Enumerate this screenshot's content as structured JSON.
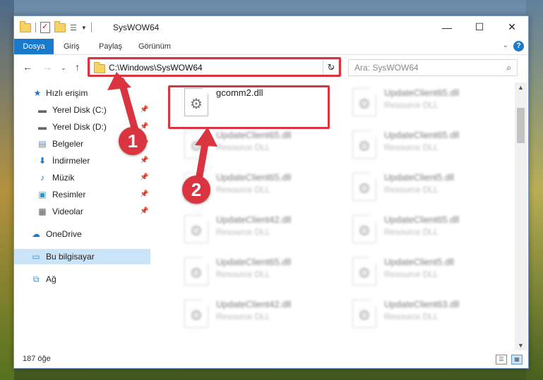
{
  "window": {
    "title": "SysWOW64"
  },
  "ribbon": {
    "tabs": [
      "Dosya",
      "Giriş",
      "Paylaş",
      "Görünüm"
    ]
  },
  "address": {
    "path": "C:\\Windows\\SysWOW64"
  },
  "search": {
    "placeholder": "Ara: SysWOW64"
  },
  "sidebar": {
    "items": [
      {
        "label": "Hızlı erişim",
        "icon": "star-icon",
        "pinned": false
      },
      {
        "label": "Yerel Disk (C:)",
        "icon": "drive-icon",
        "pinned": true
      },
      {
        "label": "Yerel Disk (D:)",
        "icon": "drive-icon",
        "pinned": true
      },
      {
        "label": "Belgeler",
        "icon": "document-icon",
        "pinned": true
      },
      {
        "label": "İndirmeler",
        "icon": "download-icon",
        "pinned": true
      },
      {
        "label": "Müzik",
        "icon": "music-icon",
        "pinned": true
      },
      {
        "label": "Resimler",
        "icon": "picture-icon",
        "pinned": true
      },
      {
        "label": "Videolar",
        "icon": "video-icon",
        "pinned": true
      },
      {
        "label": "OneDrive",
        "icon": "cloud-icon",
        "pinned": false
      },
      {
        "label": "Bu bilgisayar",
        "icon": "computer-icon",
        "pinned": false,
        "selected": true
      },
      {
        "label": "Ağ",
        "icon": "network-icon",
        "pinned": false
      }
    ]
  },
  "files": {
    "left": [
      {
        "name": "gcomm2.dll",
        "type": "",
        "blurred": false
      },
      {
        "name": "UpdateClient65.dll",
        "type": "Resource DLL",
        "blurred": true
      },
      {
        "name": "UpdateClient65.dll",
        "type": "Resource DLL",
        "blurred": true
      },
      {
        "name": "UpdateClient42.dll",
        "type": "Resource DLL",
        "blurred": true
      },
      {
        "name": "UpdateClient65.dll",
        "type": "Resource DLL",
        "blurred": true
      },
      {
        "name": "UpdateClient42.dll",
        "type": "Resource DLL",
        "blurred": true
      }
    ],
    "right": [
      {
        "name": "UpdateClient65.dll",
        "type": "Resource DLL",
        "blurred": true
      },
      {
        "name": "UpdateClient65.dll",
        "type": "Resource DLL",
        "blurred": true
      },
      {
        "name": "UpdateClient5.dll",
        "type": "Resource DLL",
        "blurred": true
      },
      {
        "name": "UpdateClient65.dll",
        "type": "Resource DLL",
        "blurred": true
      },
      {
        "name": "UpdateClient5.dll",
        "type": "Resource DLL",
        "blurred": true
      },
      {
        "name": "UpdateClient63.dll",
        "type": "Resource DLL",
        "blurred": true
      }
    ]
  },
  "status": {
    "count": "187 öğe"
  },
  "annotations": {
    "marker1": "1",
    "marker2": "2",
    "color": "#d9343f"
  }
}
